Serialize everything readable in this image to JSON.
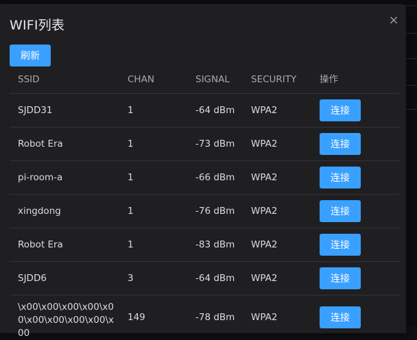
{
  "modal": {
    "title": "WIFI列表",
    "close_label": "×",
    "refresh_label": "刷新"
  },
  "table": {
    "headers": {
      "ssid": "SSID",
      "chan": "CHAN",
      "signal": "SIGNAL",
      "security": "SECURITY",
      "action": "操作"
    },
    "connect_label": "连接",
    "rows": [
      {
        "ssid": "SJDD31",
        "chan": "1",
        "signal": "-64 dBm",
        "security": "WPA2"
      },
      {
        "ssid": "Robot Era",
        "chan": "1",
        "signal": "-73 dBm",
        "security": "WPA2"
      },
      {
        "ssid": "pi-room-a",
        "chan": "1",
        "signal": "-66 dBm",
        "security": "WPA2"
      },
      {
        "ssid": "xingdong",
        "chan": "1",
        "signal": "-76 dBm",
        "security": "WPA2"
      },
      {
        "ssid": "Robot Era",
        "chan": "1",
        "signal": "-83 dBm",
        "security": "WPA2"
      },
      {
        "ssid": "SJDD6",
        "chan": "3",
        "signal": "-64 dBm",
        "security": "WPA2"
      },
      {
        "ssid": "\\x00\\x00\\x00\\x00\\x00\\x00\\x00\\x00\\x00\\x00",
        "chan": "149",
        "signal": "-78 dBm",
        "security": "WPA2"
      }
    ]
  }
}
